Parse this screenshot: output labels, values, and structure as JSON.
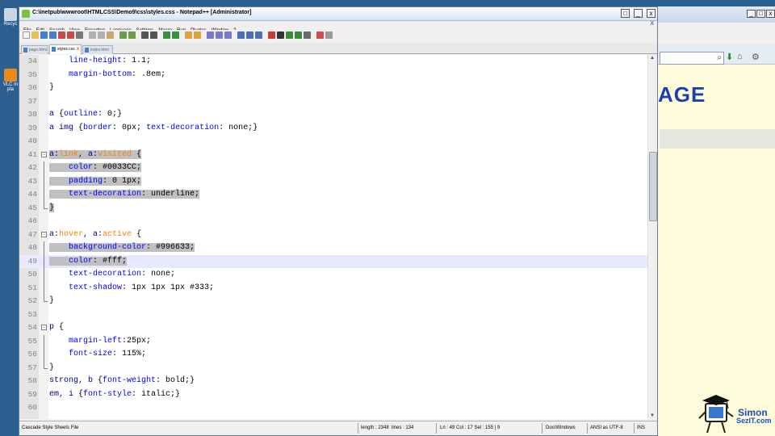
{
  "colors": {
    "desktop": "#2a5f8f",
    "selector": "#000080",
    "property": "#0000ff",
    "pseudo": "#ff8000",
    "selection": "#c0c0c0",
    "current_line": "#e8e8ff",
    "browser_heading": "#1a3fb0",
    "browser_bg": "#fdfbd9"
  },
  "desktop": {
    "icons": [
      {
        "label": "Recyc",
        "icon": "recycle-bin-icon"
      },
      {
        "label": "VLC m pla",
        "icon": "vlc-icon"
      }
    ]
  },
  "browser": {
    "heading": "AGE",
    "search_icon": "search-icon",
    "go_icon": "green-arrow-icon"
  },
  "npp": {
    "title": "C:\\inetpub\\wwwroot\\HTMLCSS\\Demo9\\css\\styles.css - Notepad++ [Administrator]",
    "menu": [
      "File",
      "Edit",
      "Search",
      "View",
      "Encoding",
      "Language",
      "Settings",
      "Macro",
      "Run",
      "Plugins",
      "Window",
      "?"
    ],
    "menu_close": "X",
    "tabs": [
      {
        "label": "page.html",
        "active": false
      },
      {
        "label": "styles.css",
        "active": true
      },
      {
        "label": "index.html",
        "active": false
      }
    ],
    "lines": [
      {
        "n": "34",
        "text": "    line-height: 1.1;"
      },
      {
        "n": "35",
        "text": "    margin-bottom: .8em;"
      },
      {
        "n": "36",
        "text": "}"
      },
      {
        "n": "37",
        "text": ""
      },
      {
        "n": "38",
        "text": "a {outline: 0;}"
      },
      {
        "n": "39",
        "text": "a img {border: 0px; text-decoration: none;}"
      },
      {
        "n": "40",
        "text": ""
      },
      {
        "n": "41",
        "text": "a:link, a:visited {"
      },
      {
        "n": "42",
        "text": "    color: #0033CC;"
      },
      {
        "n": "43",
        "text": "    padding: 0 1px;"
      },
      {
        "n": "44",
        "text": "    text-decoration: underline;"
      },
      {
        "n": "45",
        "text": "}"
      },
      {
        "n": "46",
        "text": ""
      },
      {
        "n": "47",
        "text": "a:hover, a:active {"
      },
      {
        "n": "48",
        "text": "    background-color: #996633;"
      },
      {
        "n": "49",
        "text": "    color: #fff;"
      },
      {
        "n": "50",
        "text": "    text-decoration: none;"
      },
      {
        "n": "51",
        "text": "    text-shadow: 1px 1px 1px #333;"
      },
      {
        "n": "52",
        "text": "}"
      },
      {
        "n": "53",
        "text": ""
      },
      {
        "n": "54",
        "text": "p {"
      },
      {
        "n": "55",
        "text": "    margin-left:25px;"
      },
      {
        "n": "56",
        "text": "    font-size: 115%;"
      },
      {
        "n": "57",
        "text": "}"
      },
      {
        "n": "58",
        "text": "strong, b {font-weight: bold;}"
      },
      {
        "n": "59",
        "text": "em, i {font-style: italic;}"
      },
      {
        "n": "60",
        "text": ""
      }
    ],
    "status": {
      "filetype": "Cascade Style Sheets File",
      "length": "length : 2348",
      "lines": "lines : 134",
      "position": "Ln : 49   Col : 17   Sel : 155 | 9",
      "eol": "Dos\\Windows",
      "encoding": "ANSI as UTF-8",
      "mode": "INS"
    }
  },
  "logo": {
    "line1": "Simon",
    "line2": "SezIT.com"
  }
}
